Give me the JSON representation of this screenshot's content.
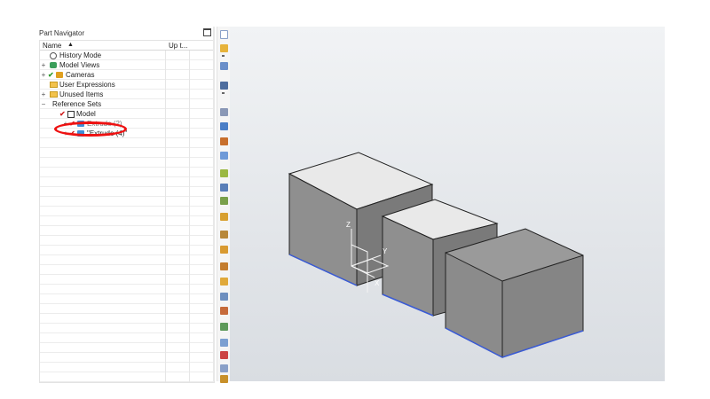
{
  "navigator": {
    "title": "Part Navigator",
    "columns": {
      "name": "Name",
      "up_to_date": "Up t..."
    },
    "rows": [
      {
        "label": "History Mode"
      },
      {
        "label": "Model Views"
      },
      {
        "label": "Cameras"
      },
      {
        "label": "User Expressions"
      },
      {
        "label": "Unused Items"
      },
      {
        "label": "Reference Sets"
      },
      {
        "label": "Model"
      },
      {
        "label": "Extrude (2)"
      },
      {
        "label": "\"Extrude (4)\""
      }
    ]
  },
  "toolbar": {
    "icons": [
      "new-icon",
      "open-icon",
      "zoom-icon",
      "save-icon",
      "measure-icon",
      "show-hide-icon",
      "snap-view-icon",
      "orient-view-icon",
      "feature-icon",
      "feature-2-icon",
      "feature-3-icon",
      "sketch-icon",
      "datum-icon",
      "datum-2-icon",
      "body-icon",
      "body-2-icon",
      "curve-icon",
      "curve-2-icon",
      "edit-icon",
      "assembly-icon",
      "assembly-2-icon",
      "dimension-icon",
      "analysis-icon"
    ]
  },
  "viewport": {
    "triad": {
      "z_label": "Z",
      "y_label": "Y",
      "x_label": "X"
    },
    "colors": {
      "face_top": "#e9e9e9",
      "face_side": "#8f8f8f",
      "face_front": "#737373",
      "edge": "#222222",
      "bottom_edge": "#3a5bd6"
    }
  },
  "annotation": {
    "highlight_color": "#ee1111"
  }
}
